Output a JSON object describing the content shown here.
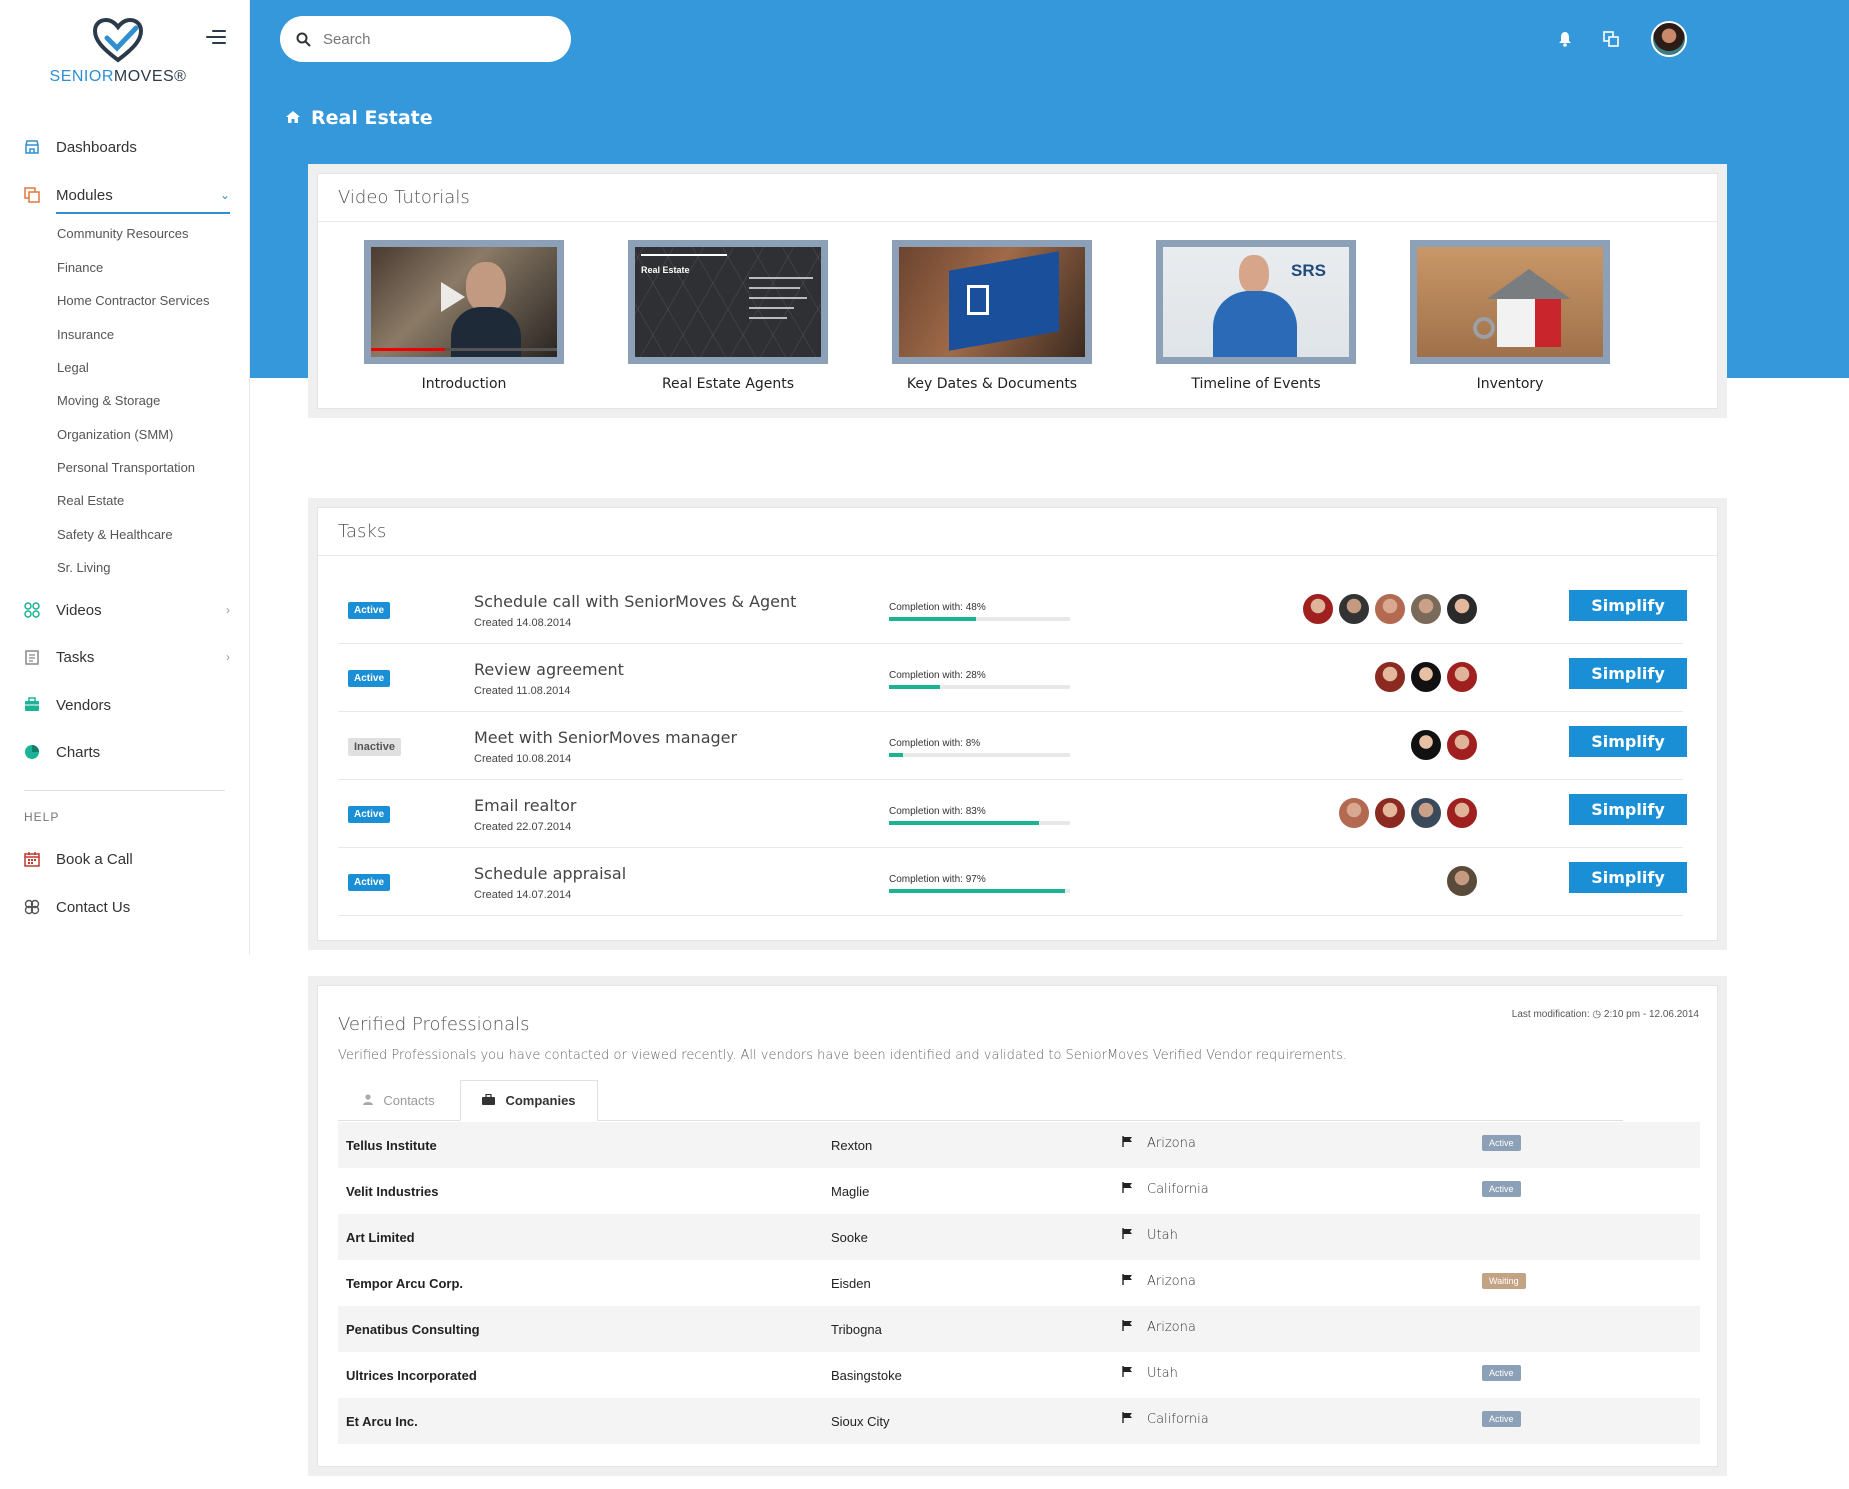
{
  "brand": {
    "name_part1": "SENIOR",
    "name_part2": "MOVES",
    "reg": "®"
  },
  "sidebar": {
    "items": [
      {
        "label": "Dashboards",
        "icon": "store-icon"
      },
      {
        "label": "Modules",
        "icon": "layers-icon"
      },
      {
        "label": "Videos",
        "icon": "grid-icon"
      },
      {
        "label": "Tasks",
        "icon": "clipboard-icon"
      },
      {
        "label": "Vendors",
        "icon": "briefcase-icon"
      },
      {
        "label": "Charts",
        "icon": "pie-chart-icon"
      }
    ],
    "modules_sub": [
      "Community Resources",
      "Finance",
      "Home Contractor Services",
      "Insurance",
      "Legal",
      "Moving & Storage",
      "Organization (SMM)",
      "Personal Transportation",
      "Real Estate",
      "Safety & Healthcare",
      "Sr. Living"
    ],
    "help_label": "HELP",
    "help_items": [
      {
        "label": "Book a Call",
        "icon": "calendar-icon"
      },
      {
        "label": "Contact Us",
        "icon": "contact-icon"
      }
    ]
  },
  "header": {
    "search_placeholder": "Search",
    "page_title": "Real Estate"
  },
  "videos": {
    "title": "Video Tutorials",
    "items": [
      {
        "label": "Introduction"
      },
      {
        "label": "Real Estate Agents",
        "thumb_title": "Real Estate"
      },
      {
        "label": "Key Dates & Documents"
      },
      {
        "label": "Timeline of Events",
        "thumb_logo": "SRS"
      },
      {
        "label": "Inventory"
      }
    ]
  },
  "tasks": {
    "title": "Tasks",
    "completion_prefix": "Completion with: ",
    "button_label": "Simplify",
    "rows": [
      {
        "status": "Active",
        "name": "Schedule call with SeniorMoves & Agent",
        "created": "Created 14.08.2014",
        "completion": 48,
        "avatars": 5
      },
      {
        "status": "Active",
        "name": "Review agreement",
        "created": "Created 11.08.2014",
        "completion": 28,
        "avatars": 3
      },
      {
        "status": "Inactive",
        "name": "Meet with SeniorMoves manager",
        "created": "Created 10.08.2014",
        "completion": 8,
        "avatars": 2
      },
      {
        "status": "Active",
        "name": "Email realtor",
        "created": "Created 22.07.2014",
        "completion": 83,
        "avatars": 4
      },
      {
        "status": "Active",
        "name": "Schedule appraisal",
        "created": "Created 14.07.2014",
        "completion": 97,
        "avatars": 1
      }
    ]
  },
  "verified": {
    "title": "Verified Professionals",
    "description": "Verified Professionals you have contacted or viewed recently. All vendors have been identified and validated to SeniorMoves Verified Vendor requirements.",
    "last_mod_label": "Last modification:",
    "last_mod_value": "2:10 pm - 12.06.2014",
    "tab_contacts": "Contacts",
    "tab_companies": "Companies",
    "rows": [
      {
        "company": "Tellus Institute",
        "city": "Rexton",
        "state": "Arizona",
        "status": "Active"
      },
      {
        "company": "Velit Industries",
        "city": "Maglie",
        "state": "California",
        "status": "Active"
      },
      {
        "company": "Art Limited",
        "city": "Sooke",
        "state": "Utah",
        "status": ""
      },
      {
        "company": "Tempor Arcu Corp.",
        "city": "Eisden",
        "state": "Arizona",
        "status": "Waiting"
      },
      {
        "company": "Penatibus Consulting",
        "city": "Tribogna",
        "state": "Arizona",
        "status": ""
      },
      {
        "company": "Ultrices Incorporated",
        "city": "Basingstoke",
        "state": "Utah",
        "status": "Active"
      },
      {
        "company": "Et Arcu Inc.",
        "city": "Sioux City",
        "state": "California",
        "status": "Active"
      }
    ]
  },
  "colors": {
    "primary": "#3498db",
    "button": "#1a8fd6",
    "progress": "#1ab394",
    "status_active": "#8ca1b8",
    "status_waiting": "#c4a384"
  }
}
